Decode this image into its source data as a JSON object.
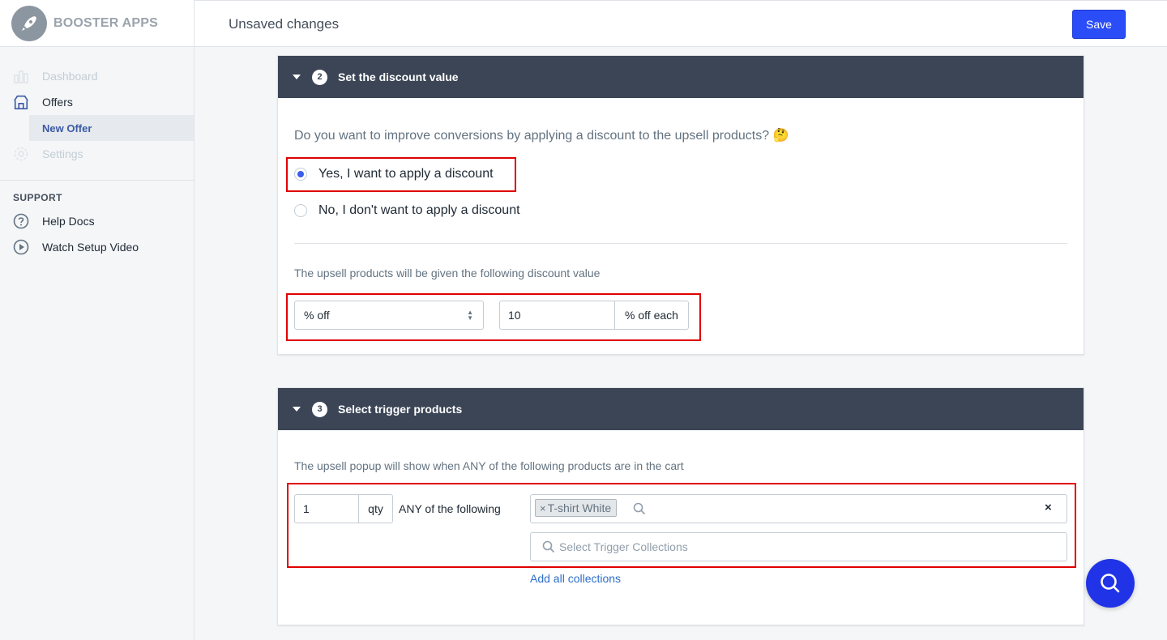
{
  "app": {
    "brand": "BOOSTER APPS"
  },
  "sidebar": {
    "items": [
      {
        "label": "Dashboard",
        "icon": "bar-chart-icon",
        "disabled": true
      },
      {
        "label": "Offers",
        "icon": "storefront-icon"
      },
      {
        "label": "New Offer",
        "active": true
      },
      {
        "label": "Settings",
        "icon": "gear-icon",
        "disabled": true
      }
    ],
    "support_title": "SUPPORT",
    "support_items": [
      {
        "label": "Help Docs",
        "icon": "question-circle-icon"
      },
      {
        "label": "Watch Setup Video",
        "icon": "play-circle-icon"
      }
    ]
  },
  "topbar": {
    "title": "Unsaved changes",
    "save_label": "Save"
  },
  "discount_card": {
    "step": "2",
    "title": "Set the discount value",
    "question": "Do you want to improve conversions by applying a discount to the upsell products? 🤔",
    "option_yes": "Yes, I want to apply a discount",
    "option_no": "No, I don't want to apply a discount",
    "selected": "yes",
    "hint": "The upsell products will be given the following discount value",
    "discount_type": "% off",
    "discount_value": "10",
    "discount_suffix": "% off each"
  },
  "trigger_card": {
    "step": "3",
    "title": "Select trigger products",
    "hint": "The upsell popup will show when ANY of the following products are in the cart",
    "qty_value": "1",
    "qty_suffix": "qty",
    "any_label": "ANY of the following",
    "tag_label": "T-shirt White",
    "tag_remove": "×",
    "clear": "×",
    "collections_placeholder": "Select Trigger Collections",
    "add_all_link": "Add all collections"
  },
  "colors": {
    "primary": "#2b4df7",
    "header": "#3b4556",
    "highlight": "#e00000",
    "fab": "#2133e6"
  }
}
